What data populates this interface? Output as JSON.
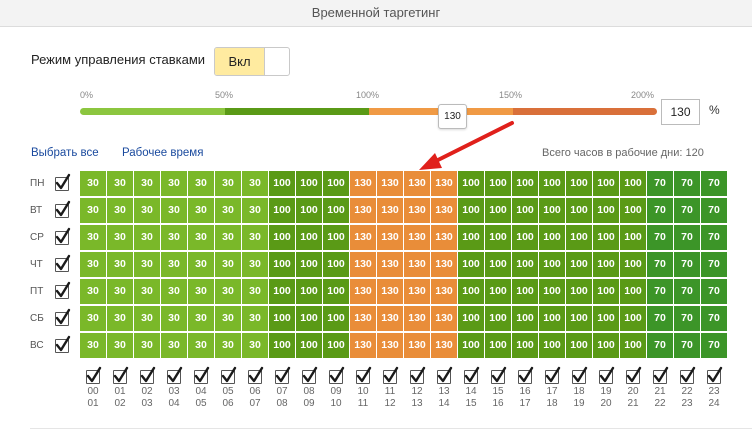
{
  "header": {
    "title": "Временной таргетинг"
  },
  "mode": {
    "label": "Режим управления ставками",
    "toggle_on_label": "Вкл"
  },
  "slider": {
    "labels": [
      "0%",
      "50%",
      "100%",
      "150%",
      "200%"
    ],
    "value": 130,
    "value_label": "130",
    "input_value": "130",
    "unit": "%",
    "colors": {
      "zone1": "#8cc63f",
      "zone2": "#5a9a16",
      "zone3": "#f09a45",
      "zone4": "#d9703a"
    }
  },
  "links": {
    "select_all": "Выбрать все",
    "work_time": "Рабочее время"
  },
  "total_hours": "Всего часов в рабочие дни: 120",
  "days": [
    "ПН",
    "ВТ",
    "СР",
    "ЧТ",
    "ПТ",
    "СБ",
    "ВС"
  ],
  "hours": [
    [
      "00",
      "01"
    ],
    [
      "01",
      "02"
    ],
    [
      "02",
      "03"
    ],
    [
      "03",
      "04"
    ],
    [
      "04",
      "05"
    ],
    [
      "05",
      "06"
    ],
    [
      "06",
      "07"
    ],
    [
      "07",
      "08"
    ],
    [
      "08",
      "09"
    ],
    [
      "09",
      "10"
    ],
    [
      "10",
      "11"
    ],
    [
      "11",
      "12"
    ],
    [
      "12",
      "13"
    ],
    [
      "13",
      "14"
    ],
    [
      "14",
      "15"
    ],
    [
      "15",
      "16"
    ],
    [
      "16",
      "17"
    ],
    [
      "17",
      "18"
    ],
    [
      "18",
      "19"
    ],
    [
      "19",
      "20"
    ],
    [
      "20",
      "21"
    ],
    [
      "21",
      "22"
    ],
    [
      "22",
      "23"
    ],
    [
      "23",
      "24"
    ]
  ],
  "schedule_row": [
    "30",
    "30",
    "30",
    "30",
    "30",
    "30",
    "30",
    "100",
    "100",
    "100",
    "130",
    "130",
    "130",
    "130",
    "100",
    "100",
    "100",
    "100",
    "100",
    "100",
    "100",
    "70",
    "70",
    "70"
  ],
  "cell_colors": {
    "30": "#7ab829",
    "100": "#5a9a16",
    "130": "#e98d39",
    "70": "#3c9528"
  },
  "annotation_arrow_color": "#e0201b"
}
